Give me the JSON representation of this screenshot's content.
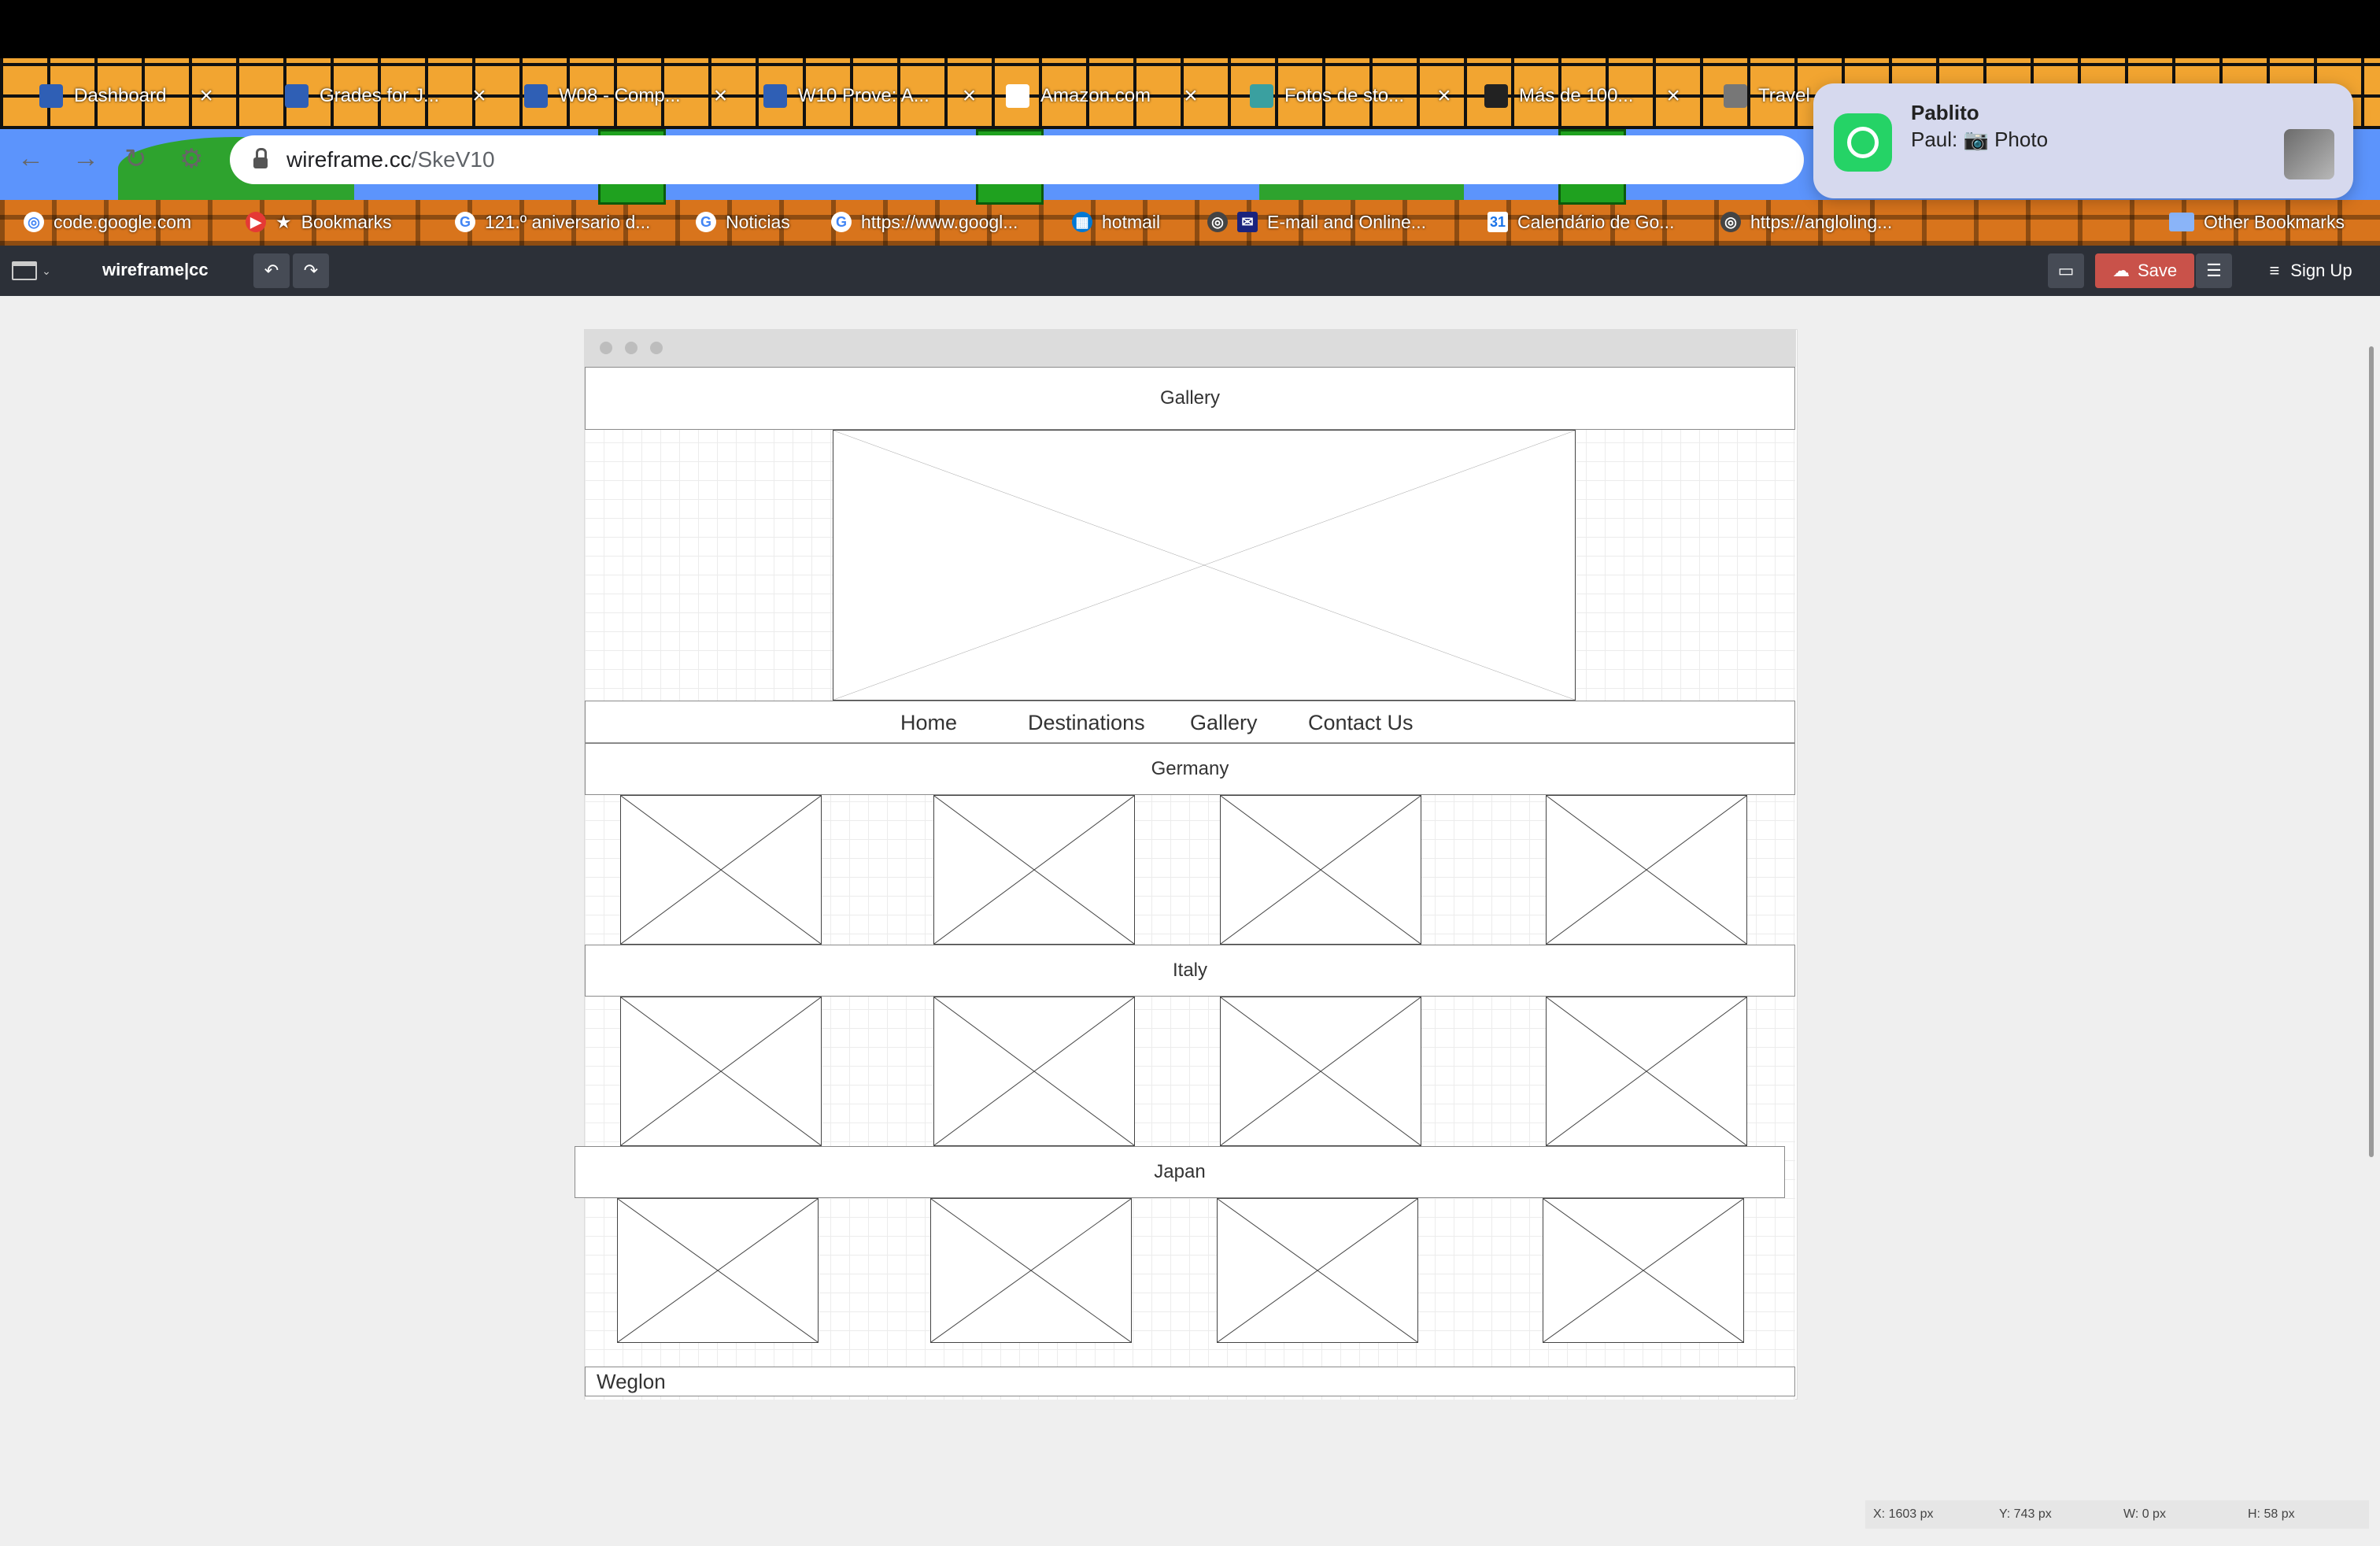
{
  "browser": {
    "tabs": [
      {
        "label": "Dashboard"
      },
      {
        "label": "Grades for J..."
      },
      {
        "label": "W08 - Comp..."
      },
      {
        "label": "W10 Prove: A..."
      },
      {
        "label": "Amazon.com"
      },
      {
        "label": "Fotos de sto..."
      },
      {
        "label": "Más de 100..."
      },
      {
        "label": "Travel"
      }
    ],
    "tab_close": "×",
    "url_host": "wireframe.cc",
    "url_path": "/SkeV10",
    "bookmarks": [
      {
        "label": "code.google.com"
      },
      {
        "label": "Bookmarks"
      },
      {
        "label": "121.º aniversario d..."
      },
      {
        "label": "Noticias"
      },
      {
        "label": "https://www.googl..."
      },
      {
        "label": "hotmail"
      },
      {
        "label": "E-mail and Online..."
      },
      {
        "label": "Calendário de Go..."
      },
      {
        "label": "https://angloling..."
      }
    ],
    "other_bookmarks": "Other Bookmarks"
  },
  "app": {
    "brand": "wireframe|cc",
    "save_label": "Save",
    "signup_label": "Sign Up"
  },
  "wireframe": {
    "header": "Gallery",
    "nav": [
      "Home",
      "Destinations",
      "Gallery",
      "Contact Us"
    ],
    "sections": [
      "Germany",
      "Italy",
      "Japan"
    ],
    "footer": "Weglon"
  },
  "notification": {
    "app": "WhatsApp",
    "title": "Pablito",
    "body": "Paul: 📷 Photo"
  },
  "status": {
    "x": "X: 1603 px",
    "y": "Y: 743 px",
    "w": "W: 0 px",
    "h": "H: 58 px"
  },
  "colors": {
    "toolbar": "#2c3038",
    "save": "#c9524a",
    "canvas": "#efefef"
  }
}
